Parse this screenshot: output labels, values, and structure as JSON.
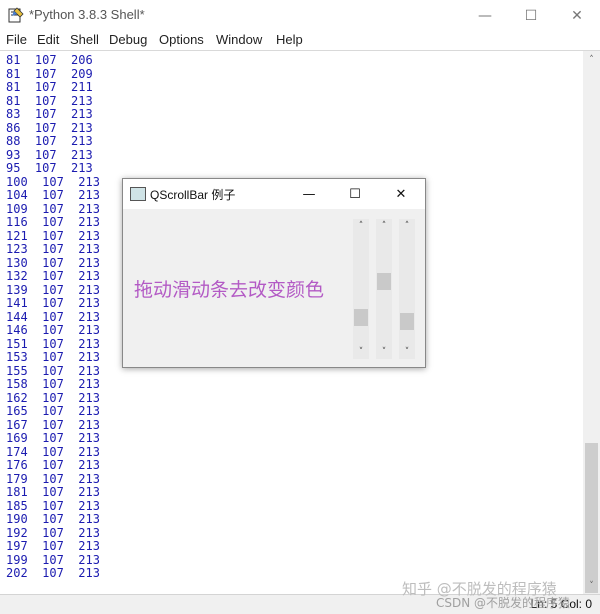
{
  "window": {
    "title": "*Python 3.8.3 Shell*",
    "minimize": "—",
    "maximize": "☐",
    "close": "✕"
  },
  "menu": [
    "File",
    "Edit",
    "Shell",
    "Debug",
    "Options",
    "Window",
    "Help"
  ],
  "output_lines": [
    "81  107  206",
    "81  107  209",
    "81  107  211",
    "81  107  213",
    "83  107  213",
    "86  107  213",
    "88  107  213",
    "93  107  213",
    "95  107  213",
    "100  107  213",
    "104  107  213",
    "109  107  213",
    "116  107  213",
    "121  107  213",
    "123  107  213",
    "130  107  213",
    "132  107  213",
    "139  107  213",
    "141  107  213",
    "144  107  213",
    "146  107  213",
    "151  107  213",
    "153  107  213",
    "155  107  213",
    "158  107  213",
    "162  107  213",
    "165  107  213",
    "167  107  213",
    "169  107  213",
    "174  107  213",
    "176  107  213",
    "179  107  213",
    "181  107  213",
    "185  107  213",
    "190  107  213",
    "192  107  213",
    "197  107  213",
    "199  107  213",
    "202  107  213"
  ],
  "status": {
    "position": "Ln: 5  Col: 0"
  },
  "watermark": {
    "line1": "知乎 @不脱发的程序猿",
    "line2": "CSDN @不脱发的程序猿"
  },
  "dialog": {
    "title": "QScrollBar 例子",
    "minimize": "—",
    "maximize": "☐",
    "close": "✕",
    "label": "拖动滑动条去改变颜色",
    "label_color": "#b35ac5",
    "scrollbars": [
      {
        "name": "red",
        "value_fraction": 0.8
      },
      {
        "name": "green",
        "value_fraction": 0.42
      },
      {
        "name": "blue",
        "value_fraction": 0.84
      }
    ]
  },
  "icons": {
    "up": "˄",
    "down": "˅"
  }
}
